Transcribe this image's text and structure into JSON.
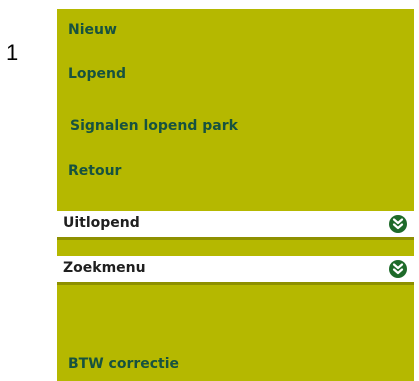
{
  "marker": "1",
  "menu": {
    "items": [
      {
        "label": "Nieuw"
      },
      {
        "label": "Lopend"
      },
      {
        "label": "Signalen lopend park"
      },
      {
        "label": "Retour"
      }
    ],
    "sections": [
      {
        "label": "Uitlopend",
        "icon": "double-chevron-down-icon"
      },
      {
        "label": "Zoekmenu",
        "icon": "double-chevron-down-icon"
      }
    ],
    "bottom_item": {
      "label": "BTW correctie"
    }
  },
  "colors": {
    "panel": "#b5b800",
    "link_text": "#17523f",
    "icon_circle": "#1e6a2a"
  }
}
